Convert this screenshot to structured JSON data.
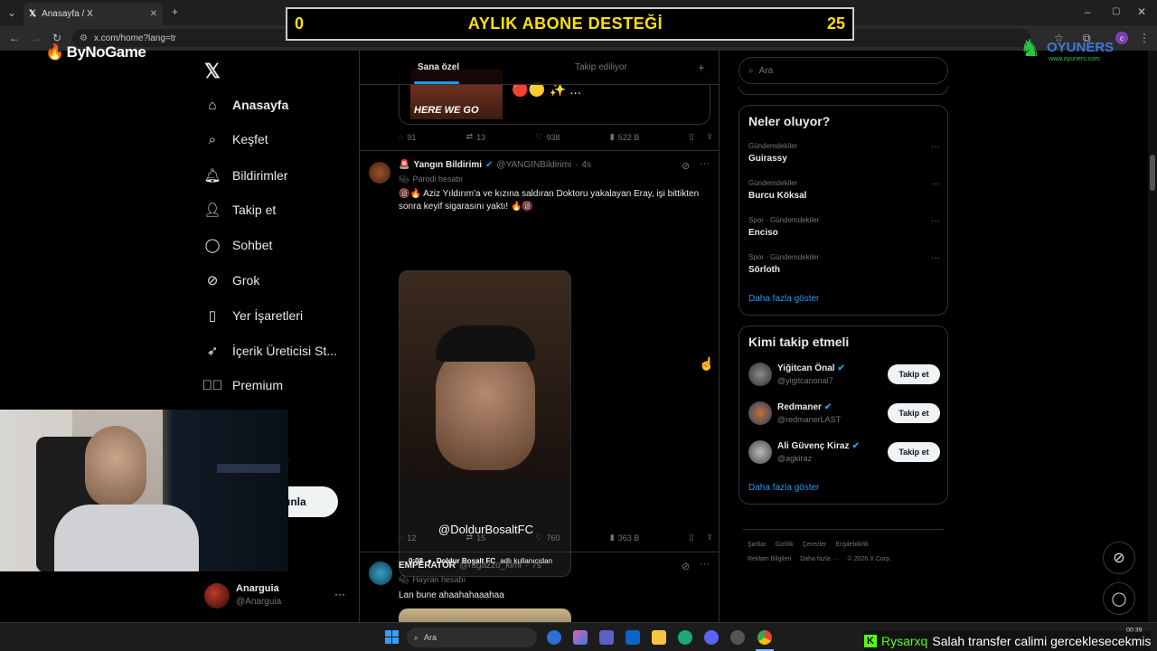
{
  "browser": {
    "tab_title": "Anasayfa / X",
    "url": "x.com/home?lang=tr"
  },
  "overlay": {
    "banner_left": "0",
    "banner_title": "AYLIK ABONE DESTEĞİ",
    "banner_right": "25",
    "brand_left": "ByNoGame",
    "brand_right": "OYUNERS",
    "brand_right_sub": "www.oyuners.com",
    "ticker_user": "Rysarxq",
    "ticker_text": "Salah transfer calimi gerceklesecekmis"
  },
  "nav": {
    "items": [
      {
        "label": "Anasayfa",
        "icon": "home-icon"
      },
      {
        "label": "Keşfet",
        "icon": "search-icon"
      },
      {
        "label": "Bildirimler",
        "icon": "bell-icon"
      },
      {
        "label": "Takip et",
        "icon": "follow-icon"
      },
      {
        "label": "Sohbet",
        "icon": "chat-icon"
      },
      {
        "label": "Grok",
        "icon": "grok-icon"
      },
      {
        "label": "Yer İşaretleri",
        "icon": "bookmark-icon"
      },
      {
        "label": "İçerik Üreticisi St...",
        "icon": "rocket-icon"
      },
      {
        "label": "Premium",
        "icon": "verified-icon"
      }
    ],
    "post_button_partial": "ınla",
    "partial_a": "a",
    "account_name": "Anarguia",
    "account_handle": "@Anarguia"
  },
  "feed": {
    "tabs": [
      "Sana özel",
      "Takip ediliyor"
    ],
    "tweet0": {
      "emojis": "🔴🟡 ✨ ...",
      "image_text": "HERE WE GO",
      "replies": "91",
      "reposts": "13",
      "likes": "938",
      "views": "522 B"
    },
    "tweet1": {
      "name": "Yangın Bildirimi",
      "handle": "@YANGINBildirimi",
      "time": "4s",
      "badge": "Parodi hesabı",
      "text": "Aziz Yıldırım'a ve kızına saldıran Doktoru yakalayan Eray, işi bittikten sonra keyif sigarasını  yaktı!",
      "video_watermark": "@DoldurBosaltFC",
      "video_time": "0:08",
      "video_source_name": "Doldur Boşalt FC",
      "video_source_suffix": "adlı kullanıcıdan",
      "replies": "12",
      "reposts": "15",
      "likes": "760",
      "views": "363 B"
    },
    "tweet2": {
      "name": "EMPERATOR",
      "handle": "@ragazzo_kimi",
      "time": "7s",
      "badge": "Hayran hesabı",
      "text": "Lan bune ahaahahaaahaa"
    }
  },
  "right": {
    "search_placeholder": "Ara",
    "trends_title": "Neler oluyor?",
    "trends": [
      {
        "context": "Gündemdekiler",
        "name": "Guirassy"
      },
      {
        "context": "Gündemdekiler",
        "name": "Burcu Köksal"
      },
      {
        "context": "Spor · Gündemdekiler",
        "name": "Enciso"
      },
      {
        "context": "Spor · Gündemdekiler",
        "name": "Sörloth"
      }
    ],
    "show_more": "Daha fazla göster",
    "follow_title": "Kimi takip etmeli",
    "follow_button": "Takip et",
    "suggestions": [
      {
        "name": "Yiğitcan Önal",
        "handle": "@yigitcanonal7"
      },
      {
        "name": "Redmaner",
        "handle": "@redmanerLAST"
      },
      {
        "name": "Ali Güvenç Kiraz",
        "handle": "@agkiraz"
      }
    ],
    "footer_row1": [
      "Şartlar",
      "Gizlilik",
      "Çerezler",
      "Erişilebilirlik"
    ],
    "footer_row2": [
      "Reklam Bilgileri",
      "Daha fazla ···",
      "© 2026 X Corp."
    ]
  },
  "taskbar": {
    "search_label": "Ara",
    "clock": "00:39"
  },
  "colors": {
    "accent": "#1d9bf0",
    "banner_text": "#ffe100",
    "verified": "#1d9bf0"
  }
}
